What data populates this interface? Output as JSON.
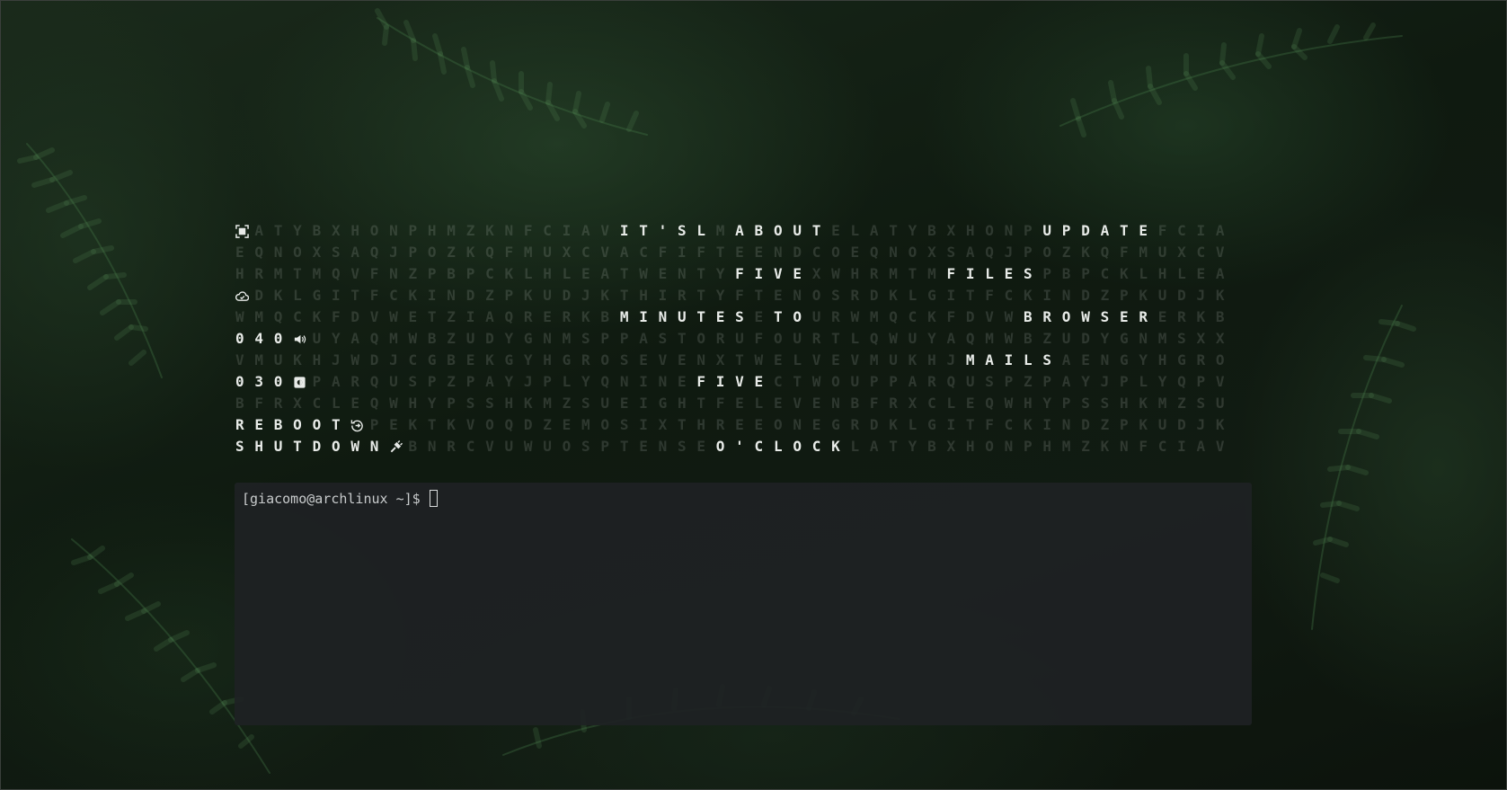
{
  "colors": {
    "lit_letter": "#e8ebe8",
    "dim_letter": "rgba(210,215,210,0.16)",
    "terminal_bg": "#1e2123",
    "terminal_text": "#c8cbcc"
  },
  "clock_grid": {
    "rows": [
      {
        "label": "",
        "icon": "screenshot-icon",
        "letters": "ATYBXHONPHMZKNFCIAVIT'SLMABOUTELATYBXHONPUPDATEFCIA",
        "lit": [
          [
            19,
            23
          ],
          [
            25,
            29
          ],
          [
            41,
            46
          ]
        ]
      },
      {
        "label": "",
        "icon": "",
        "letters": "EQNOXSAQJPOZKQFMUXCVACFIFTEENDCOEQNOXSAQJPOZKQFMUXCV",
        "lit": []
      },
      {
        "label": "",
        "icon": "",
        "letters": "HRMTMQVFNZPBPCKLHLEATWENTYFIVEXWHRMTMFILESPBPCKLHLEA",
        "lit": [
          [
            26,
            29
          ],
          [
            37,
            41
          ]
        ]
      },
      {
        "label": "",
        "icon": "cloud-icon",
        "letters": "DKLGITFCKINDZPKUDJKTHIRTYFTENOSRDKLGITFCKINDZPKUDJK",
        "lit": []
      },
      {
        "label": "",
        "icon": "",
        "letters": "WMQCKFDVWETZIAQRERKBMINUTESETOURWMQCKFDVWBROWSERERKB",
        "lit": [
          [
            20,
            26
          ],
          [
            28,
            29
          ],
          [
            41,
            47
          ]
        ]
      },
      {
        "label": "040",
        "icon": "volume-icon",
        "letters": "UYAQMWBZUDYGNMSPPASTORUFOURTLQWUYAQMWBZUDYGNMSXX",
        "lit": []
      },
      {
        "label": "",
        "icon": "",
        "letters": "VMUKHJWDJCGBEKGYHGROSEVENXTWELVEVMUKHJMAILSAENGYHGRO",
        "lit": [
          [
            38,
            42
          ]
        ]
      },
      {
        "label": "030",
        "icon": "brightness-icon",
        "letters": "PARQUSPZPAYJPLYQNINEFIVECTWOUPPARQUSPZPAYJPLYQPV",
        "lit": [
          [
            20,
            23
          ]
        ]
      },
      {
        "label": "",
        "icon": "",
        "letters": "BFRXCLEQWHYPSSHKMZSUEIGHTFELEVENBFRXCLEQWHYPSSHKMZSU",
        "lit": []
      },
      {
        "label": "REBOOT",
        "icon": "reboot-icon",
        "letters": "PEKTKVOQDZEMOSIXTHREEONEGRDKLGITFCKINDZPKUDJK",
        "lit": []
      },
      {
        "label": "SHUTDOWN",
        "icon": "plug-icon",
        "letters": "BNRCVUWUOSPTENSEO'CLOCKLATYBXHONPHMZKNFCIAV",
        "lit": [
          [
            16,
            22
          ]
        ]
      }
    ]
  },
  "terminal": {
    "prompt": "[giacomo@archlinux ~]$"
  }
}
